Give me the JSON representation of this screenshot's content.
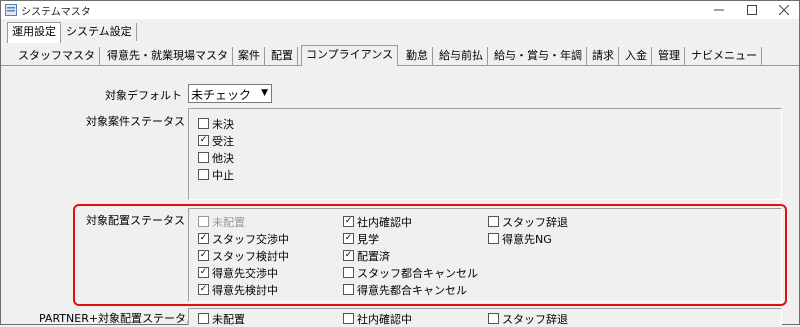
{
  "window": {
    "title": "システムマスタ"
  },
  "outer_tabs": [
    {
      "label": "運用設定",
      "active": true
    },
    {
      "label": "システム設定",
      "active": false
    }
  ],
  "inner_tabs": [
    {
      "label": "スタッフマスタ"
    },
    {
      "label": "得意先・就業現場マスタ"
    },
    {
      "label": "案件"
    },
    {
      "label": "配置"
    },
    {
      "label": "コンプライアンス",
      "active": true
    },
    {
      "label": "勤怠"
    },
    {
      "label": "給与前払"
    },
    {
      "label": "給与・賞与・年調"
    },
    {
      "label": "請求"
    },
    {
      "label": "入金"
    },
    {
      "label": "管理"
    },
    {
      "label": "ナビメニュー"
    }
  ],
  "default_target": {
    "label": "対象デフォルト",
    "value": "未チェック"
  },
  "case_status": {
    "label": "対象案件ステータス",
    "items": [
      {
        "label": "未決",
        "checked": false
      },
      {
        "label": "受注",
        "checked": true
      },
      {
        "label": "他決",
        "checked": false
      },
      {
        "label": "中止",
        "checked": false
      }
    ]
  },
  "placement_status": {
    "label": "対象配置ステータス",
    "items": [
      {
        "label": "未配置",
        "checked": false,
        "disabled": true
      },
      {
        "label": "スタッフ交渉中",
        "checked": true
      },
      {
        "label": "スタッフ検討中",
        "checked": true
      },
      {
        "label": "得意先交渉中",
        "checked": true
      },
      {
        "label": "得意先検討中",
        "checked": true
      },
      {
        "label": "社内確認中",
        "checked": true
      },
      {
        "label": "見学",
        "checked": true
      },
      {
        "label": "配置済",
        "checked": true
      },
      {
        "label": "スタッフ都合キャンセル",
        "checked": false
      },
      {
        "label": "得意先都合キャンセル",
        "checked": false
      },
      {
        "label": "スタッフ辞退",
        "checked": false
      },
      {
        "label": "得意先NG",
        "checked": false
      }
    ]
  },
  "partner_status": {
    "label": "PARTNER+対象配置ステータス",
    "items": [
      {
        "label": "未配置",
        "checked": false
      },
      {
        "label": "社内確認中",
        "checked": false
      },
      {
        "label": "スタッフ辞退",
        "checked": false
      }
    ]
  },
  "colors": {
    "highlight": "#e01010",
    "background": "#f0f0f0"
  }
}
